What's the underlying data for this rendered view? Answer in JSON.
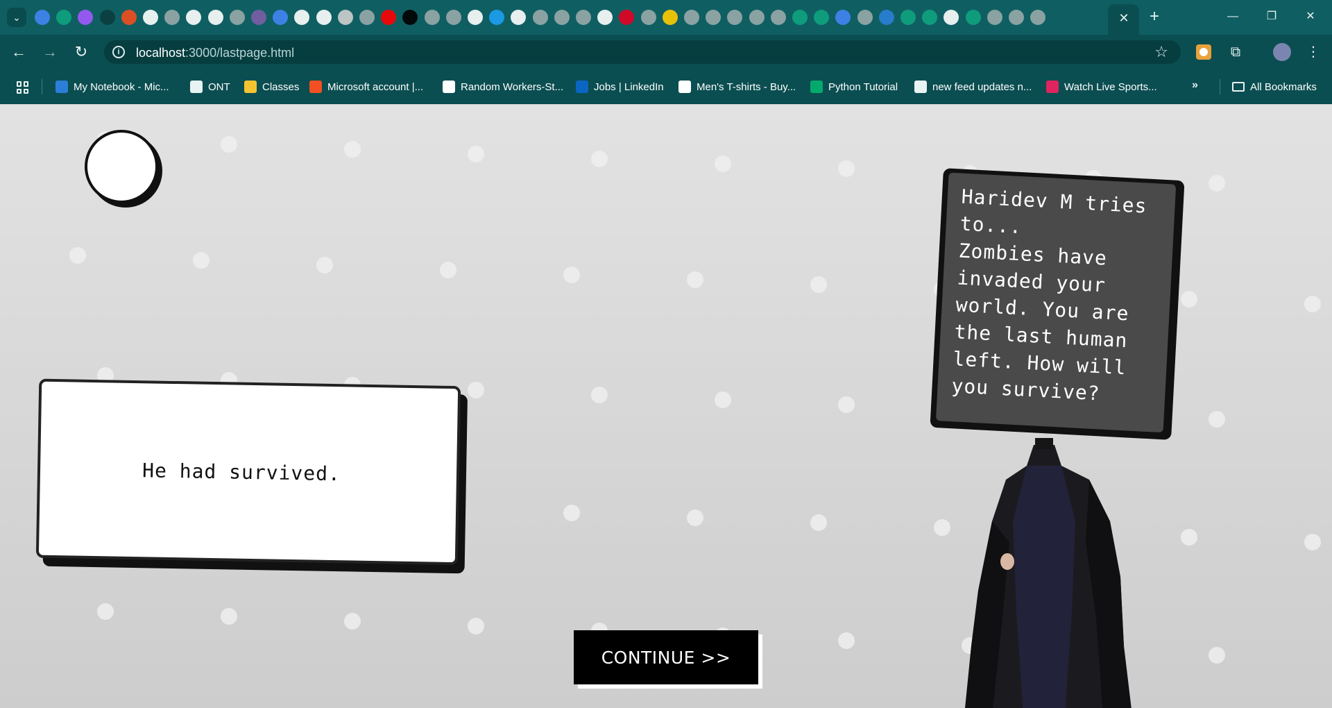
{
  "browser": {
    "tabs": {
      "active_close": "✕",
      "new_tab": "+"
    },
    "window_controls": {
      "minimize": "—",
      "restore": "❐",
      "close": "✕"
    },
    "address_bar": {
      "host": "localhost",
      "path": ":3000/lastpage.html"
    },
    "bookmarks": [
      {
        "label": "My Notebook - Mic...",
        "icon": "onedrive-icon",
        "color": "#2b7fd8"
      },
      {
        "label": "ONT",
        "icon": "globe-icon",
        "color": "#e8f4f4"
      },
      {
        "label": "Classes",
        "icon": "classroom-icon",
        "color": "#f4c430"
      },
      {
        "label": "Microsoft account |...",
        "icon": "microsoft-icon",
        "color": "#f25022"
      },
      {
        "label": "Random Workers-St...",
        "icon": "page-icon",
        "color": "#ffffff"
      },
      {
        "label": "Jobs | LinkedIn",
        "icon": "linkedin-icon",
        "color": "#0a66c2"
      },
      {
        "label": "Men's T-shirts - Buy...",
        "icon": "shop-icon",
        "color": "#ffffff"
      },
      {
        "label": "Python Tutorial",
        "icon": "w3schools-icon",
        "color": "#04aa6d"
      },
      {
        "label": "new feed updates n...",
        "icon": "globe-icon",
        "color": "#e8f4f4"
      },
      {
        "label": "Watch Live Sports...",
        "icon": "hotstar-icon",
        "color": "#e0245e"
      }
    ],
    "bookmarks_more": "»",
    "all_bookmarks": "All Bookmarks"
  },
  "page": {
    "story_text": "He had survived.",
    "speech_text": "Haridev M tries\nto...\nZombies have\ninvaded your\nworld. You are\nthe last human\nleft. How will\nyou survive?",
    "continue_label": "CONTINUE >>"
  }
}
